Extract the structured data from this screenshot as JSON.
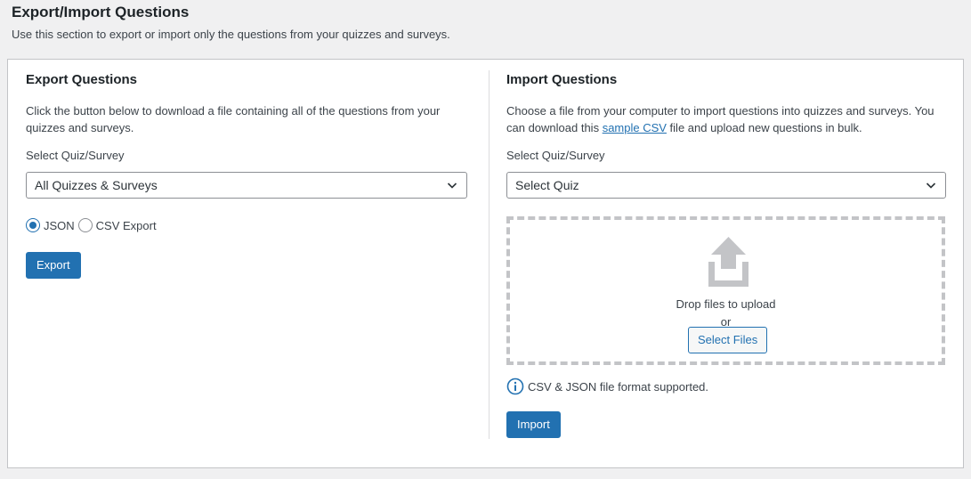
{
  "header": {
    "title": "Export/Import Questions",
    "description": "Use this section to export or import only the questions from your quizzes and surveys."
  },
  "export": {
    "title": "Export Questions",
    "description": "Click the button below to download a file containing all of the questions from your quizzes and surveys.",
    "select_label": "Select Quiz/Survey",
    "select_value": "All Quizzes & Surveys",
    "format_options": [
      {
        "label": "JSON",
        "checked": true
      },
      {
        "label": "CSV Export",
        "checked": false
      }
    ],
    "button_label": "Export"
  },
  "import": {
    "title": "Import Questions",
    "description_before": "Choose a file from your computer to import questions into quizzes and surveys. You can download this ",
    "link_text": "sample CSV",
    "description_after": " file and upload new questions in bulk.",
    "select_label": "Select Quiz/Survey",
    "select_value": "Select Quiz",
    "drop_text": "Drop files to upload",
    "or_text": "or",
    "select_files_label": "Select Files",
    "info_text": "CSV & JSON file format supported.",
    "button_label": "Import"
  },
  "icons": {
    "upload": "upload-icon",
    "info": "info-icon",
    "chevron": "chevron-down-icon"
  },
  "colors": {
    "accent": "#2271b1",
    "icon_gray": "#c3c4c7"
  }
}
